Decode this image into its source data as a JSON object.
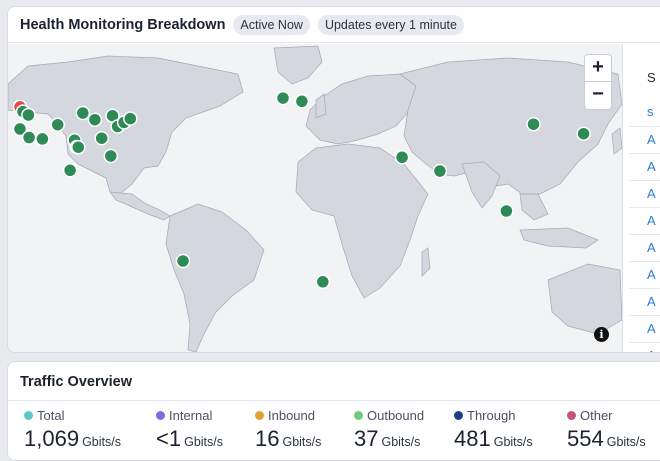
{
  "health": {
    "title": "Health Monitoring Breakdown",
    "badges": [
      "Active Now",
      "Updates every 1 minute"
    ]
  },
  "map": {
    "zoom_in_label": "+",
    "zoom_out_label": "−",
    "info_label": "i",
    "land_color": "#d4d7dd",
    "ocean_color": "#f2f3f5",
    "healthy_color": "#2e8b57",
    "alert_color": "#e5484d",
    "markers": [
      {
        "status": "alert",
        "lon": -122.4,
        "lat": 47.6
      },
      {
        "status": "healthy",
        "lon": -121.0,
        "lat": 45.5
      },
      {
        "status": "healthy",
        "lon": -118.5,
        "lat": 44.0
      },
      {
        "status": "healthy",
        "lon": -122.4,
        "lat": 37.8
      },
      {
        "status": "healthy",
        "lon": -118.2,
        "lat": 34.0
      },
      {
        "status": "healthy",
        "lon": -112.0,
        "lat": 33.4
      },
      {
        "status": "healthy",
        "lon": -104.9,
        "lat": 39.7
      },
      {
        "status": "healthy",
        "lon": -97.0,
        "lat": 32.8
      },
      {
        "status": "healthy",
        "lon": -96.0,
        "lat": 29.8
      },
      {
        "status": "healthy",
        "lon": -95.3,
        "lat": 29.7
      },
      {
        "status": "healthy",
        "lon": -93.2,
        "lat": 44.9
      },
      {
        "status": "healthy",
        "lon": -87.6,
        "lat": 41.9
      },
      {
        "status": "healthy",
        "lon": -84.4,
        "lat": 33.7
      },
      {
        "status": "healthy",
        "lon": -80.2,
        "lat": 25.8
      },
      {
        "status": "healthy",
        "lon": -79.4,
        "lat": 43.7
      },
      {
        "status": "healthy",
        "lon": -77.0,
        "lat": 38.9
      },
      {
        "status": "healthy",
        "lon": -74.0,
        "lat": 40.7
      },
      {
        "status": "healthy",
        "lon": -71.1,
        "lat": 42.4
      },
      {
        "status": "healthy",
        "lon": -99.1,
        "lat": 19.4
      },
      {
        "status": "healthy",
        "lon": -46.6,
        "lat": -23.5
      },
      {
        "status": "healthy",
        "lon": -0.1,
        "lat": 51.5
      },
      {
        "status": "healthy",
        "lon": 8.7,
        "lat": 50.1
      },
      {
        "status": "healthy",
        "lon": 18.4,
        "lat": -33.9
      },
      {
        "status": "healthy",
        "lon": 55.3,
        "lat": 25.2
      },
      {
        "status": "healthy",
        "lon": 72.9,
        "lat": 19.1
      },
      {
        "status": "healthy",
        "lon": 103.8,
        "lat": 1.35
      },
      {
        "status": "healthy",
        "lon": 116.4,
        "lat": 39.9
      },
      {
        "status": "healthy",
        "lon": 139.7,
        "lat": 35.7
      }
    ]
  },
  "side_list": {
    "header": "S",
    "items": [
      "s",
      "A",
      "A",
      "A",
      "A",
      "A",
      "A",
      "A",
      "A",
      "A"
    ]
  },
  "traffic": {
    "title": "Traffic Overview",
    "metrics": [
      {
        "label": "Total",
        "value": "1,069",
        "unit": "Gbits/s",
        "color": "#5ec8c8"
      },
      {
        "label": "Internal",
        "value": "<1",
        "unit": "Gbits/s",
        "color": "#7b6fe0"
      },
      {
        "label": "Inbound",
        "value": "16",
        "unit": "Gbits/s",
        "color": "#e0a13c"
      },
      {
        "label": "Outbound",
        "value": "37",
        "unit": "Gbits/s",
        "color": "#6bcf7a"
      },
      {
        "label": "Through",
        "value": "481",
        "unit": "Gbits/s",
        "color": "#1f3f8a"
      },
      {
        "label": "Other",
        "value": "554",
        "unit": "Gbits/s",
        "color": "#c4557a"
      }
    ]
  }
}
